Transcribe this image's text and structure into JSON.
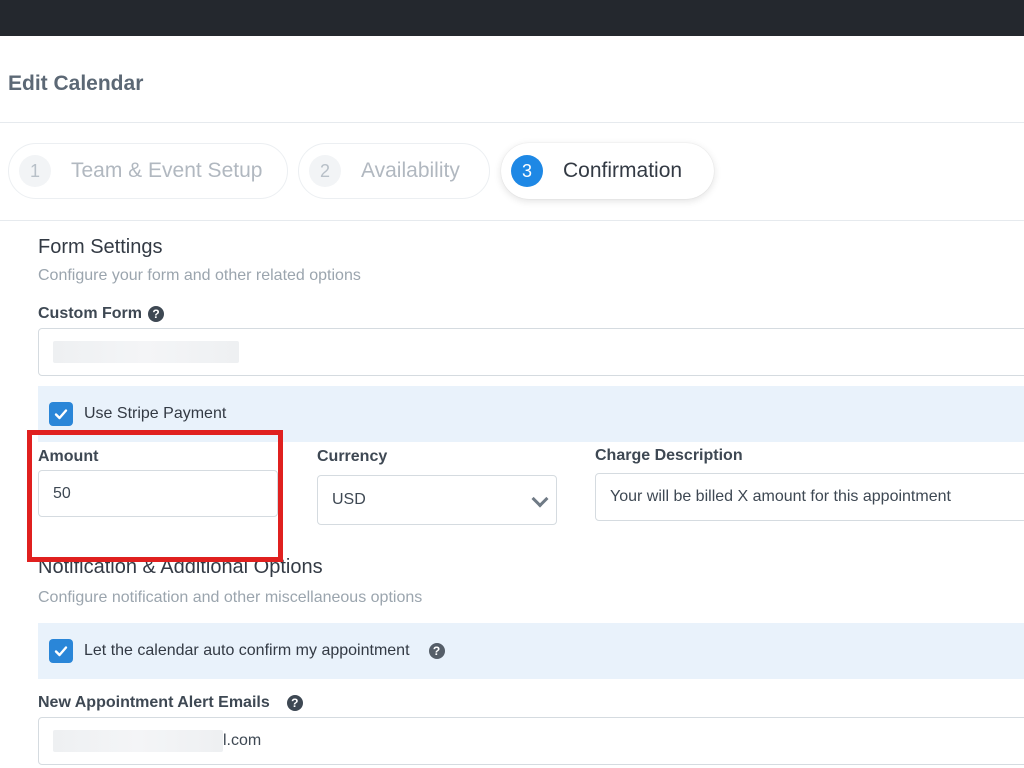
{
  "page": {
    "title": "Edit Calendar"
  },
  "steps": [
    {
      "number": "1",
      "label": "Team & Event Setup",
      "active": false
    },
    {
      "number": "2",
      "label": "Availability",
      "active": false
    },
    {
      "number": "3",
      "label": "Confirmation",
      "active": true
    }
  ],
  "form_settings": {
    "title": "Form Settings",
    "subtitle": "Configure your form and other related options",
    "custom_form_label": "Custom Form",
    "use_stripe_label": "Use Stripe Payment",
    "use_stripe_checked": true,
    "amount_label": "Amount",
    "amount_value": "50",
    "currency_label": "Currency",
    "currency_value": "USD",
    "charge_description_label": "Charge Description",
    "charge_description_value": "Your will be billed X amount for this appointment"
  },
  "notification": {
    "title": "Notification & Additional Options",
    "subtitle": "Configure notification and other miscellaneous options",
    "auto_confirm_label": "Let the calendar auto confirm my appointment",
    "auto_confirm_checked": true,
    "alert_emails_label": "New Appointment Alert Emails",
    "alert_emails_value_suffix": "l.com"
  },
  "colors": {
    "accent": "#1e88e5",
    "topbar": "#24282e",
    "highlight_box": "#e0201f",
    "checkbox_row_bg": "#e9f2fb"
  },
  "icons": [
    "help-circle-icon",
    "check-icon",
    "chevron-down-icon"
  ]
}
